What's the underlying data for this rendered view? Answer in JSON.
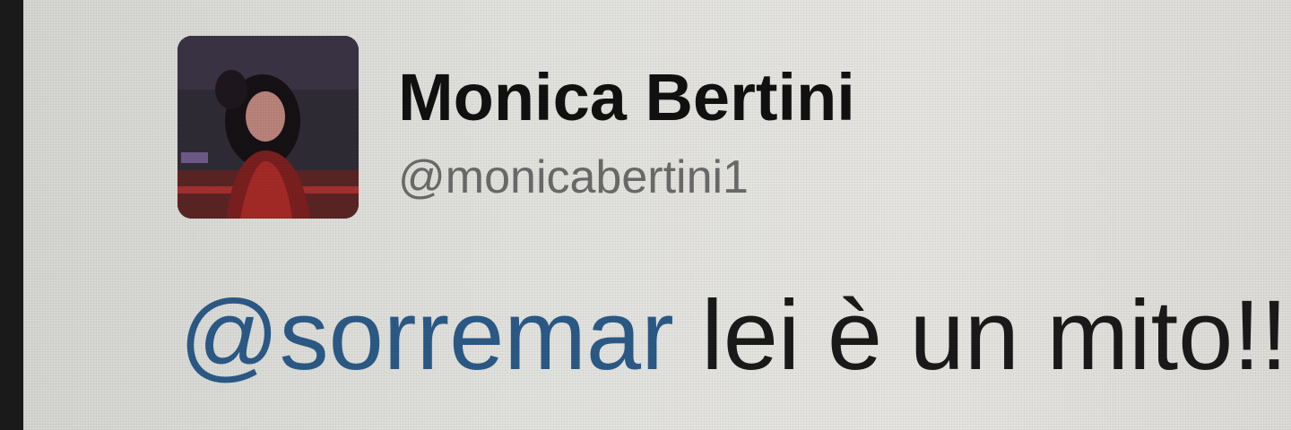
{
  "tweet": {
    "author": {
      "display_name": "Monica Bertini",
      "handle": "@monicabertini1",
      "avatar_icon": "user-avatar-photo"
    },
    "text": {
      "mention": "@sorremar",
      "body": " lei è un mito!!!"
    }
  },
  "colors": {
    "mention": "#2b5a86",
    "name": "#111111",
    "handle": "#6a6a6a"
  }
}
